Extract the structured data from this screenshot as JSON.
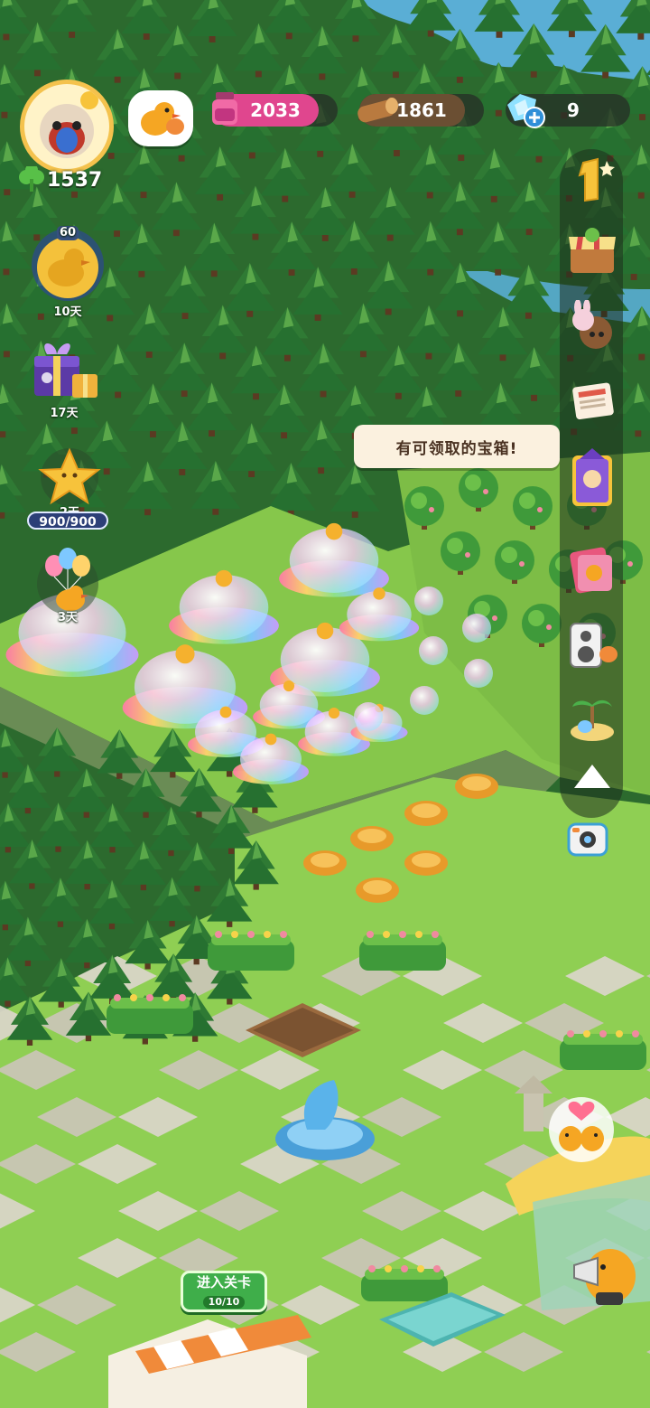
{
  "hud": {
    "clover_count": "1537",
    "resources": [
      {
        "name": "potion",
        "value": "2033",
        "fill_fraction": 0.85,
        "fill_color": "#e0468e"
      },
      {
        "name": "wood",
        "value": "1861",
        "fill_fraction": 0.85,
        "fill_color": "#6b4f33"
      },
      {
        "name": "gem",
        "value": "9",
        "fill_fraction": 0.0,
        "fill_color": "#4fb3e8"
      }
    ]
  },
  "events": [
    {
      "name": "golden-duck-event",
      "badge": "60",
      "timer": "10天"
    },
    {
      "name": "gift-box-event",
      "timer": "17天"
    },
    {
      "name": "star-event",
      "timer": "2天",
      "progress": "900/900"
    },
    {
      "name": "balloon-duck-event",
      "timer": "3天"
    }
  ],
  "right_menu": {
    "items": [
      "rank-one-icon",
      "shop-stall-icon",
      "bunny-bear-icon",
      "newspaper-icon",
      "witch-card-icon",
      "cat-card-book-icon",
      "speaker-icon",
      "island-icon"
    ],
    "collapse": "triangle-up-icon",
    "camera": "camera-icon"
  },
  "speech": {
    "text": "有可领取的宝箱!"
  },
  "level_button": {
    "label": "进入关卡",
    "count": "10/10"
  },
  "colors": {
    "grass": "#7fc24a",
    "forest": "#2f6b2f",
    "tile": "#d9d6c7"
  }
}
